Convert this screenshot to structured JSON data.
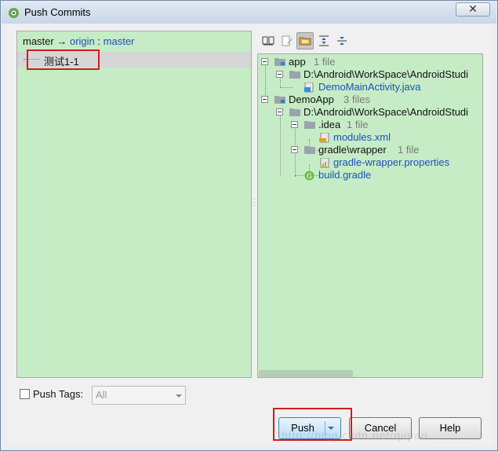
{
  "window": {
    "title": "Push Commits",
    "close_glyph": "✕"
  },
  "left": {
    "branch": {
      "local": "master",
      "arrow": "→",
      "remote": "origin",
      "separator": ":",
      "remote_branch": "master"
    },
    "commits": [
      {
        "label": "测试1-1"
      }
    ]
  },
  "toolbar": {
    "buttons": [
      "diff-icon",
      "edit-source-icon",
      "group-by-directory-icon",
      "expand-all-icon",
      "collapse-all-icon"
    ]
  },
  "tree": [
    {
      "name": "app",
      "count": "1 file"
    },
    {
      "name": "D:\\Android\\WorkSpace\\AndroidStudi"
    },
    {
      "name": "DemoMainActivity.java"
    },
    {
      "name": "DemoApp",
      "count": "3 files"
    },
    {
      "name": "D:\\Android\\WorkSpace\\AndroidStudi"
    },
    {
      "name": ".idea",
      "count": "1 file"
    },
    {
      "name": "modules.xml"
    },
    {
      "name": "gradle\\wrapper",
      "count": "1 file"
    },
    {
      "name": "gradle-wrapper.properties"
    },
    {
      "name": "build.gradle"
    }
  ],
  "tags": {
    "label": "Push Tags:",
    "checked": false,
    "select_value": "All"
  },
  "buttons": {
    "push": "Push",
    "cancel": "Cancel",
    "help": "Help"
  },
  "watermark": "http://blog.csdn.net/qiqiao",
  "colors": {
    "panel_bg": "#c6ecc6",
    "link": "#1d4fbf",
    "highlight": "#d01c1c"
  }
}
